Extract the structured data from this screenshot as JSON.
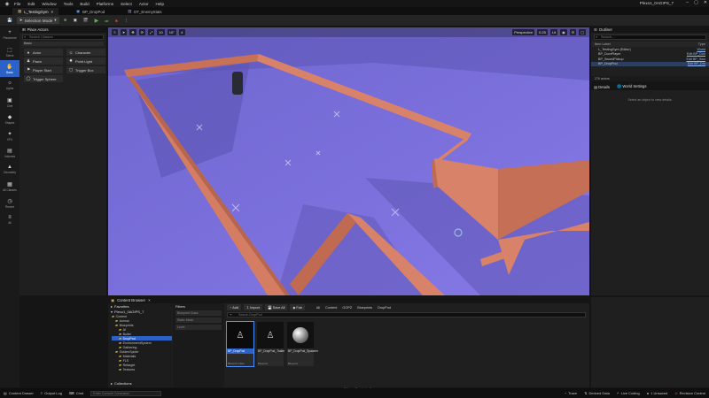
{
  "menubar": {
    "items": [
      "File",
      "Edit",
      "Window",
      "Tools",
      "Build",
      "Platforms",
      "Select",
      "Actor",
      "Help"
    ],
    "project": "Plexo1_0AGIPS_7"
  },
  "tabs": [
    {
      "label": "L_TestingGym"
    },
    {
      "label": "BP_DropPod"
    },
    {
      "label": "DT_EnemyStats"
    }
  ],
  "toolbar": {
    "selection_mode": "Selection Mode",
    "perspective": "Perspective",
    "lit": "Lit",
    "grid_snap": "10",
    "rot_snap": "10°",
    "scale_snap": "0.25",
    "cam_speed": "4"
  },
  "modes": [
    {
      "label": "Placement",
      "icon": "+"
    },
    {
      "label": "Select",
      "icon": "⬚"
    },
    {
      "label": "Basic",
      "icon": "✋"
    },
    {
      "label": "Lights",
      "icon": "☼"
    },
    {
      "label": "Cine",
      "icon": "▣"
    },
    {
      "label": "Shapes",
      "icon": "◆"
    },
    {
      "label": "VFX",
      "icon": "✦"
    },
    {
      "label": "Volumes",
      "icon": "▤"
    },
    {
      "label": "Geometry",
      "icon": "▲"
    },
    {
      "label": "All Classes",
      "icon": "▦"
    },
    {
      "label": "Recent",
      "icon": "◷"
    },
    {
      "label": "All",
      "icon": "≡"
    }
  ],
  "place_actors": {
    "title": "Place Actors",
    "search_placeholder": "Search Classes",
    "category": "Basic",
    "items": [
      {
        "label": "Actor",
        "icon": "●"
      },
      {
        "label": "Character",
        "icon": "☺"
      },
      {
        "label": "Pawn",
        "icon": "♟"
      },
      {
        "label": "Point Light",
        "icon": "✹"
      },
      {
        "label": "Player Start",
        "icon": "⚑"
      },
      {
        "label": "Trigger Box",
        "icon": "▢"
      },
      {
        "label": "Trigger Sphere",
        "icon": "◯"
      }
    ]
  },
  "outliner": {
    "title": "Outliner",
    "search_placeholder": "Search...",
    "col_label": "Item Label",
    "col_type": "Type",
    "rows": [
      {
        "label": "L_TestingGym (Editor)",
        "type": "World",
        "sel": false
      },
      {
        "label": "BP_DoorPlayer",
        "type": "Edit BP_Doo",
        "sel": false
      },
      {
        "label": "BP_SwordPickup",
        "type": "Edit BP_Swo",
        "sel": false
      },
      {
        "label": "BP_DropPod",
        "type": "Edit BP_Dro",
        "sel": true
      }
    ],
    "actor_count": "276 actors"
  },
  "details": {
    "tab1": "Details",
    "tab2": "World Settings",
    "empty_msg": "Select an object to view details."
  },
  "content_browser": {
    "title": "Content Browser",
    "favorites": "Favorites",
    "project": "Plexo1_0AGIPS_7",
    "tree": [
      {
        "label": "Content",
        "sel": false,
        "indent": 0
      },
      {
        "label": "Animal",
        "sel": false,
        "indent": 1
      },
      {
        "label": "Blueprints",
        "sel": false,
        "indent": 1
      },
      {
        "label": "AI",
        "sel": false,
        "indent": 2
      },
      {
        "label": "Bullet",
        "sel": false,
        "indent": 2
      },
      {
        "label": "DropPod",
        "sel": true,
        "indent": 2
      },
      {
        "label": "EnvironmentSystem",
        "sel": false,
        "indent": 2
      },
      {
        "label": "Gathering",
        "sel": false,
        "indent": 2
      },
      {
        "label": "GoldenSpider",
        "sel": false,
        "indent": 1
      },
      {
        "label": "Materials",
        "sel": false,
        "indent": 2
      },
      {
        "label": "FLS",
        "sel": false,
        "indent": 2
      },
      {
        "label": "Retarget",
        "sel": false,
        "indent": 2
      },
      {
        "label": "Textures",
        "sel": false,
        "indent": 2
      }
    ],
    "collections": "Collections",
    "filters_title": "Filters",
    "filters": [
      "Blueprint Class",
      "Static Mesh",
      "Level"
    ],
    "add": "Add",
    "import": "Import",
    "save_all": "Save All",
    "fab": "Fab",
    "breadcrumbs": [
      "All",
      "Content",
      "GOPZ",
      "Blueprints",
      "DropPod"
    ],
    "search_placeholder": "Search DropPod",
    "assets": [
      {
        "name": "BP_DropPod",
        "type": "Blueprint Class",
        "sel": true
      },
      {
        "name": "BP_DropPod_Trailer",
        "type": "Blueprint",
        "sel": false
      },
      {
        "name": "BP_DropPod_Spawner",
        "type": "Blueprint",
        "sel": false
      }
    ],
    "status": "3 items (1 selected)"
  },
  "statusbar": {
    "content_drawer": "Content Drawer",
    "output_log": "Output Log",
    "cmd": "Cmd",
    "cmd_placeholder": "Enter Console Command",
    "trace": "Trace",
    "derived_data": "Derived Data",
    "live_coding": "Live Coding",
    "unsaved": "1 Unsaved",
    "revision": "Revision Control"
  },
  "colors": {
    "floor": "#7a6fd6",
    "wall": "#d9826a",
    "accent": "#2c62c7"
  }
}
